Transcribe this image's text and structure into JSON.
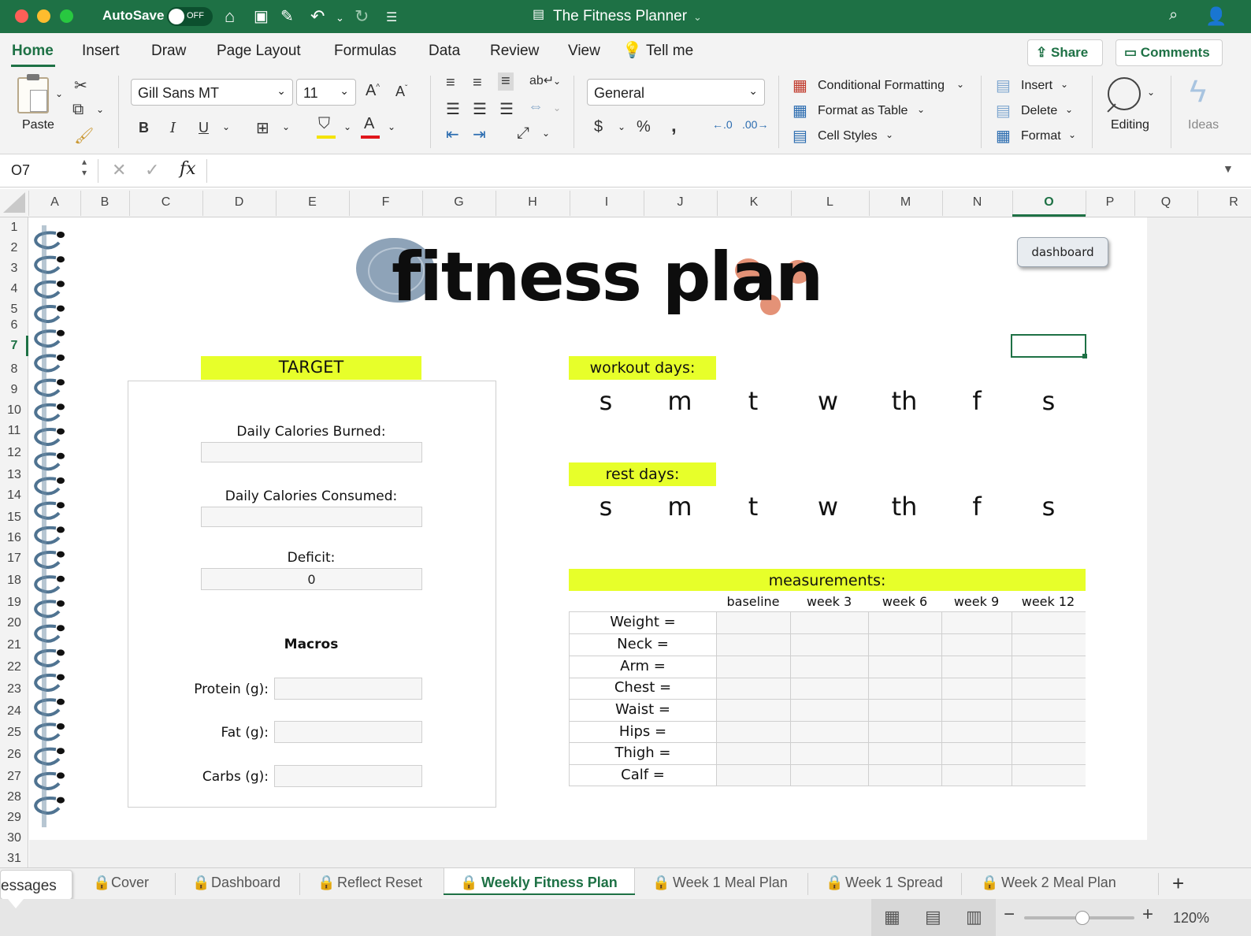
{
  "titlebar": {
    "autosave_label": "AutoSave",
    "autosave_state": "OFF",
    "doc_title": "The Fitness Planner",
    "colors": {
      "bar": "#1e7145"
    }
  },
  "ribbon_tabs": [
    "Home",
    "Insert",
    "Draw",
    "Page Layout",
    "Formulas",
    "Data",
    "Review",
    "View"
  ],
  "tell_me": "Tell me",
  "share_label": "Share",
  "comments_label": "Comments",
  "ribbon": {
    "paste_label": "Paste",
    "font_name": "Gill Sans MT",
    "font_size": "11",
    "number_format": "General",
    "conditional_formatting": "Conditional Formatting",
    "format_as_table": "Format as Table",
    "cell_styles": "Cell Styles",
    "insert": "Insert",
    "delete": "Delete",
    "format": "Format",
    "editing": "Editing",
    "ideas": "Ideas",
    "bold": "B",
    "italic": "I",
    "underline": "U",
    "currency": "$",
    "percent": "%",
    "comma": ","
  },
  "formula_bar": {
    "name_box": "O7",
    "fx": "fx",
    "value": ""
  },
  "columns": [
    "A",
    "B",
    "C",
    "D",
    "E",
    "F",
    "G",
    "H",
    "I",
    "J",
    "K",
    "L",
    "M",
    "N",
    "O",
    "P",
    "Q",
    "R"
  ],
  "rows": [
    "1",
    "2",
    "3",
    "4",
    "5",
    "6",
    "7",
    "8",
    "9",
    "10",
    "11",
    "12",
    "13",
    "14",
    "15",
    "16",
    "17",
    "18",
    "19",
    "20",
    "21",
    "22",
    "23",
    "24",
    "25",
    "26",
    "27",
    "28",
    "29",
    "30",
    "31"
  ],
  "sheet": {
    "title": "fitness plan",
    "dashboard_button": "dashboard",
    "target_header": "TARGET",
    "calories_burned_label": "Daily Calories Burned:",
    "calories_burned_value": "",
    "calories_consumed_label": "Daily Calories Consumed:",
    "calories_consumed_value": "",
    "deficit_label": "Deficit:",
    "deficit_value": "0",
    "macros_label": "Macros",
    "protein_label": "Protein (g):",
    "fat_label": "Fat (g):",
    "carbs_label": "Carbs (g):",
    "workout_days_header": "workout days:",
    "rest_days_header": "rest days:",
    "days": [
      "s",
      "m",
      "t",
      "w",
      "th",
      "f",
      "s"
    ],
    "measurements_header": "measurements:",
    "measurement_columns": [
      "baseline",
      "week 3",
      "week 6",
      "week 9",
      "week 12"
    ],
    "measurement_rows": [
      "Weight =",
      "Neck =",
      "Arm =",
      "Chest =",
      "Waist =",
      "Hips =",
      "Thigh =",
      "Calf ="
    ],
    "colors": {
      "highlight": "#e7ff2a",
      "blob_blue": "#8ea3b8",
      "blob_orange": "#e49277"
    }
  },
  "sheet_tabs": [
    "Cover",
    "Dashboard",
    "Reflect Reset",
    "Weekly Fitness Plan",
    "Week 1 Meal Plan",
    "Week 1 Spread",
    "Week 2 Meal Plan"
  ],
  "active_sheet_tab": "Weekly Fitness Plan",
  "messages_label": "essages",
  "zoom": "120%"
}
